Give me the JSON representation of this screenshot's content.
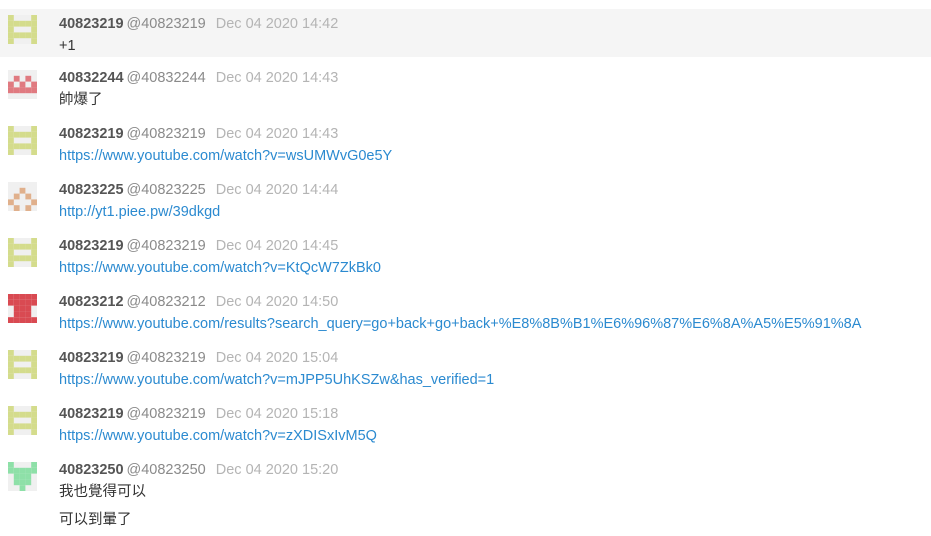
{
  "messages": [
    {
      "user": "40823219",
      "handle": "@40823219",
      "time": "Dec 04 2020 14:42",
      "avatar_icon": "ladder-identicon",
      "avatar_color": "#d4dc8c",
      "lines": [
        {
          "text": "+1",
          "link": false
        }
      ]
    },
    {
      "user": "40832244",
      "handle": "@40832244",
      "time": "Dec 04 2020 14:43",
      "avatar_icon": "crown-identicon",
      "avatar_color": "#e07a80",
      "lines": [
        {
          "text": "帥爆了",
          "link": false
        }
      ]
    },
    {
      "user": "40823219",
      "handle": "@40823219",
      "time": "Dec 04 2020 14:43",
      "avatar_icon": "ladder-identicon",
      "avatar_color": "#d4dc8c",
      "lines": [
        {
          "text": "https://www.youtube.com/watch?v=wsUMWvG0e5Y",
          "link": true
        }
      ]
    },
    {
      "user": "40823225",
      "handle": "@40823225",
      "time": "Dec 04 2020 14:44",
      "avatar_icon": "diamond-identicon",
      "avatar_color": "#e0b08c",
      "lines": [
        {
          "text": "http://yt1.piee.pw/39dkgd",
          "link": true
        }
      ]
    },
    {
      "user": "40823219",
      "handle": "@40823219",
      "time": "Dec 04 2020 14:45",
      "avatar_icon": "ladder-identicon",
      "avatar_color": "#d4dc8c",
      "lines": [
        {
          "text": "https://www.youtube.com/watch?v=KtQcW7ZkBk0",
          "link": true
        }
      ]
    },
    {
      "user": "40823212",
      "handle": "@40823212",
      "time": "Dec 04 2020 14:50",
      "avatar_icon": "block-identicon",
      "avatar_color": "#d94a52",
      "lines": [
        {
          "text": "https://www.youtube.com/results?search_query=go+back+go+back+%E8%8B%B1%E6%96%87%E6%8A%A5%E5%91%8A",
          "link": true
        }
      ]
    },
    {
      "user": "40823219",
      "handle": "@40823219",
      "time": "Dec 04 2020 15:04",
      "avatar_icon": "ladder-identicon",
      "avatar_color": "#d4dc8c",
      "lines": [
        {
          "text": "https://www.youtube.com/watch?v=mJPP5UhKSZw&has_verified=1",
          "link": true
        }
      ]
    },
    {
      "user": "40823219",
      "handle": "@40823219",
      "time": "Dec 04 2020 15:18",
      "avatar_icon": "ladder-identicon",
      "avatar_color": "#d4dc8c",
      "lines": [
        {
          "text": "https://www.youtube.com/watch?v=zXDISxIvM5Q",
          "link": true
        }
      ]
    },
    {
      "user": "40823250",
      "handle": "@40823250",
      "time": "Dec 04 2020 15:20",
      "avatar_icon": "tree-identicon",
      "avatar_color": "#8ee0a8",
      "lines": [
        {
          "text": "我也覺得可以",
          "link": false
        },
        {
          "text": "可以到暈了",
          "link": false
        }
      ]
    }
  ]
}
